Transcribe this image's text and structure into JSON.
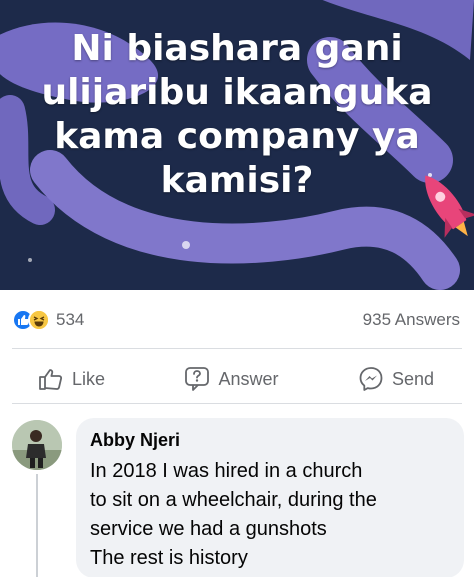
{
  "post": {
    "banner_title": "Ni biashara gani ulijaribu ikaanguka kama company ya kamisi?",
    "banner_color": "#1d2a4a",
    "accent_blob_color": "#8c7fd9",
    "reactions": {
      "icons": [
        "like-icon",
        "haha-icon"
      ],
      "count": "534"
    },
    "answers_count": "935 Answers"
  },
  "actions": {
    "like_label": "Like",
    "answer_label": "Answer",
    "send_label": "Send"
  },
  "comment": {
    "author": "Abby Njeri",
    "text": "In 2018 I was hired in a church\nto sit on a wheelchair, during the\nservice we had a gunshots\nThe rest is history"
  }
}
